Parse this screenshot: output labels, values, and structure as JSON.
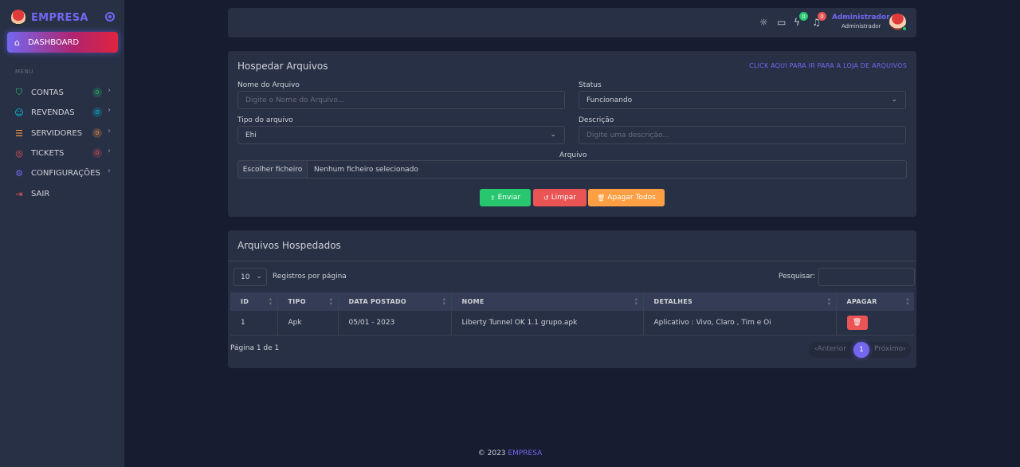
{
  "sidebar": {
    "brand": "EMPRESA",
    "dashboard_label": "DASHBOARD",
    "menu_header": "MENU",
    "items": [
      {
        "label": "CONTAS",
        "icon": "shield-icon",
        "badge": "0",
        "badge_color": "#28c76f",
        "chevron": true
      },
      {
        "label": "REVENDAS",
        "icon": "users-icon",
        "badge": "0",
        "badge_color": "#00cfe8",
        "chevron": true
      },
      {
        "label": "SERVIDORES",
        "icon": "server-icon",
        "badge": "0",
        "badge_color": "#ff9f43",
        "chevron": true
      },
      {
        "label": "TICKETS",
        "icon": "lifebuoy-icon",
        "badge": "0",
        "badge_color": "#ea5455",
        "chevron": true
      },
      {
        "label": "CONFIGURAÇÕES",
        "icon": "gear-icon",
        "badge": "",
        "badge_color": "",
        "chevron": true
      },
      {
        "label": "SAIR",
        "icon": "logout-icon",
        "badge": "",
        "badge_color": "",
        "chevron": false
      }
    ]
  },
  "header": {
    "icons": [
      "sun-icon",
      "chat-icon",
      "zap-icon",
      "bell-icon"
    ],
    "zap_badge": "0",
    "bell_badge": "0",
    "user_name": "Administrador",
    "user_role": "Administrador"
  },
  "upload": {
    "title": "Hospedar Arquivos",
    "store_link": "CLICK AQUI PARA IR PARA A LOJA DE ARQUIVOS",
    "name_label": "Nome do Arquivo",
    "name_placeholder": "Digite o Nome do Arquivo...",
    "status_label": "Status",
    "status_value": "Funcionando",
    "type_label": "Tipo do arquivo",
    "type_value": "Ehi",
    "desc_label": "Descrição",
    "desc_placeholder": "Digite uma descrição...",
    "file_label": "Arquivo",
    "file_button": "Escolher ficheiro",
    "file_text": "Nenhum ficheiro selecionado",
    "btn_send": "Enviar",
    "btn_clear": "Limpar",
    "btn_delete_all": "Apagar Todos",
    "colors": {
      "send": "#28c76f",
      "clear": "#ea5455",
      "delete_all": "#ff9f43"
    }
  },
  "hosted": {
    "title": "Arquivos Hospedados",
    "page_length": "10",
    "per_page_label": "Registros por página",
    "search_label": "Pesquisar:",
    "columns": [
      "ID",
      "TIPO",
      "DATA POSTADO",
      "NOME",
      "DETALHES",
      "APAGAR"
    ],
    "rows": [
      {
        "id": "1",
        "tipo": "Apk",
        "data": "05/01 - 2023",
        "nome": "Liberty Tunnel OK 1.1 grupo.apk",
        "detalhes": "Aplicativo : Vivo, Claro , Tim e Oi"
      }
    ],
    "page_info": "Página 1 de 1",
    "prev": "Anterior",
    "current_page": "1",
    "next": "Próximo"
  },
  "footer": {
    "copyright": "© 2023",
    "brand": "EMPRESA"
  },
  "accent": "#7367f0"
}
